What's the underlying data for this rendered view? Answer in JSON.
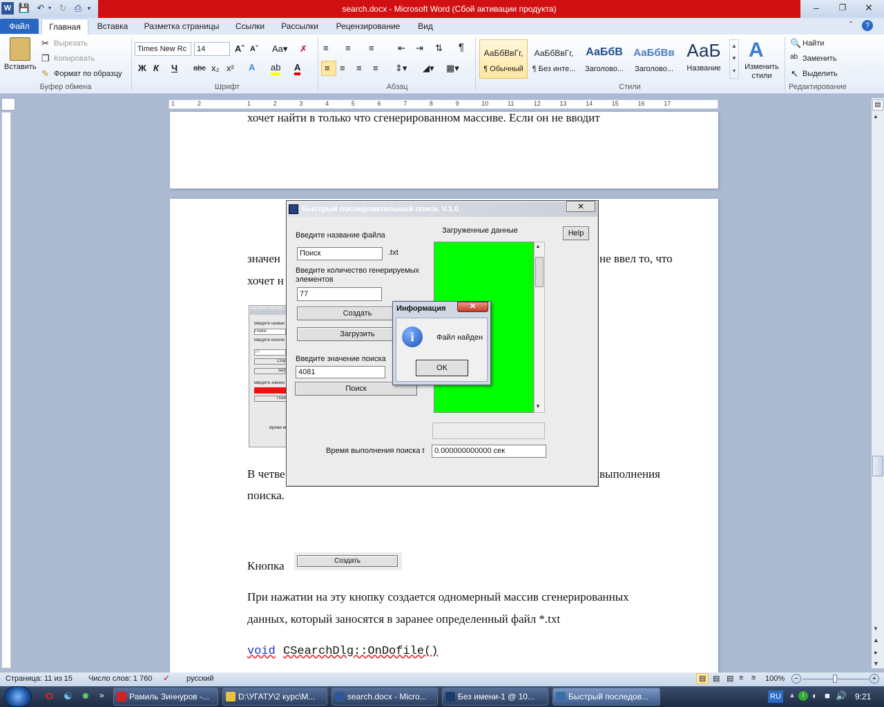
{
  "window": {
    "title": "search.docx - Microsoft Word (Сбой активации продукта)"
  },
  "tabs": [
    "Файл",
    "Главная",
    "Вставка",
    "Разметка страницы",
    "Ссылки",
    "Рассылки",
    "Рецензирование",
    "Вид"
  ],
  "clipboard": {
    "paste": "Вставить",
    "cut": "Вырезать",
    "copy": "Копировать",
    "format_painter": "Формат по образцу",
    "group": "Буфер обмена"
  },
  "font": {
    "name": "Times New Rc",
    "size": "14",
    "group": "Шрифт"
  },
  "paragraph": {
    "group": "Абзац"
  },
  "styles": {
    "group": "Стили",
    "items": [
      {
        "sample": "АаБбВвГг,",
        "name": "¶ Обычный"
      },
      {
        "sample": "АаБбВвГг,",
        "name": "¶ Без инте..."
      },
      {
        "sample": "АаБбВ",
        "name": "Заголово..."
      },
      {
        "sample": "АаБбВв",
        "name": "Заголово..."
      },
      {
        "sample": "АаБ",
        "name": "Название"
      }
    ],
    "change": "Изменить стили"
  },
  "editing": {
    "find": "Найти",
    "replace": "Заменить",
    "select": "Выделить",
    "group": "Редактирование"
  },
  "ruler_numbers": [
    "1",
    "2",
    "1",
    "2",
    "3",
    "4",
    "5",
    "6",
    "7",
    "8",
    "9",
    "10",
    "11",
    "12",
    "13",
    "14",
    "15",
    "16",
    "17"
  ],
  "doc": {
    "line1": "хочет найти в только что сгенерированном массиве. Если он не вводит",
    "behind_left": "значен",
    "behind_right": "не ввел то, что",
    "behind_left2": "хочет н",
    "behind_left3": "В четве",
    "behind_right3": "выполнения",
    "line_poiska": "поиска.",
    "knopka": "Кнопка",
    "inline_btn": "Создать",
    "para1": "При нажатии на эту кнопку создается одномерный массив сгенерированных",
    "para2": "данных, который заносятся в заранее определенный файл *.txt",
    "code_kw": "void",
    "code_rest": "CSearchDlg::OnDofile()"
  },
  "app_dialog": {
    "title": "Быстрый последовательный поиск. V.1.0",
    "file_label": "Введите название файла",
    "file_value": "Поиск",
    "ext": ".txt",
    "count_label": "Введите количество генерируемых элементов",
    "count_value": "77",
    "create": "Создать",
    "load": "Загрузить",
    "search_label": "Введите значение поиска",
    "search_value": "4081",
    "search": "Поиск",
    "loaded_label": "Загруженные данные",
    "help": "Help",
    "time_label": "Время выполнения поиска t",
    "time_value": "0.000000000000 сек",
    "list_color": "#00ff00"
  },
  "msgbox": {
    "title": "Информация",
    "text": "Файл найден",
    "ok": "OK"
  },
  "thumb": {
    "title": "Быстрый послед...",
    "label1": "Введите назван",
    "v1": "Поиск",
    "label2": "Введите количе",
    "v2": "77",
    "b1": "Созд",
    "b2": "Загр",
    "label3": "Введите значен",
    "b3": "Поис",
    "label4": "Время вып"
  },
  "status": {
    "page": "Страница: 11 из 15",
    "words": "Число слов: 1 760",
    "lang": "русский",
    "zoom": "100%"
  },
  "taskbar": {
    "items": [
      {
        "label": "Рамиль Зиннуров -...",
        "color": "#d42020"
      },
      {
        "label": "D:\\УГАТУ\\2 курс\\М...",
        "color": "#e8c040"
      },
      {
        "label": "search.docx - Micro...",
        "color": "#2b5797"
      },
      {
        "label": "Без имени-1 @ 10...",
        "color": "#1a3d6e"
      },
      {
        "label": "Быстрый последов...",
        "color": "#3a6ea8"
      }
    ],
    "lang": "RU",
    "time": "9:21"
  }
}
